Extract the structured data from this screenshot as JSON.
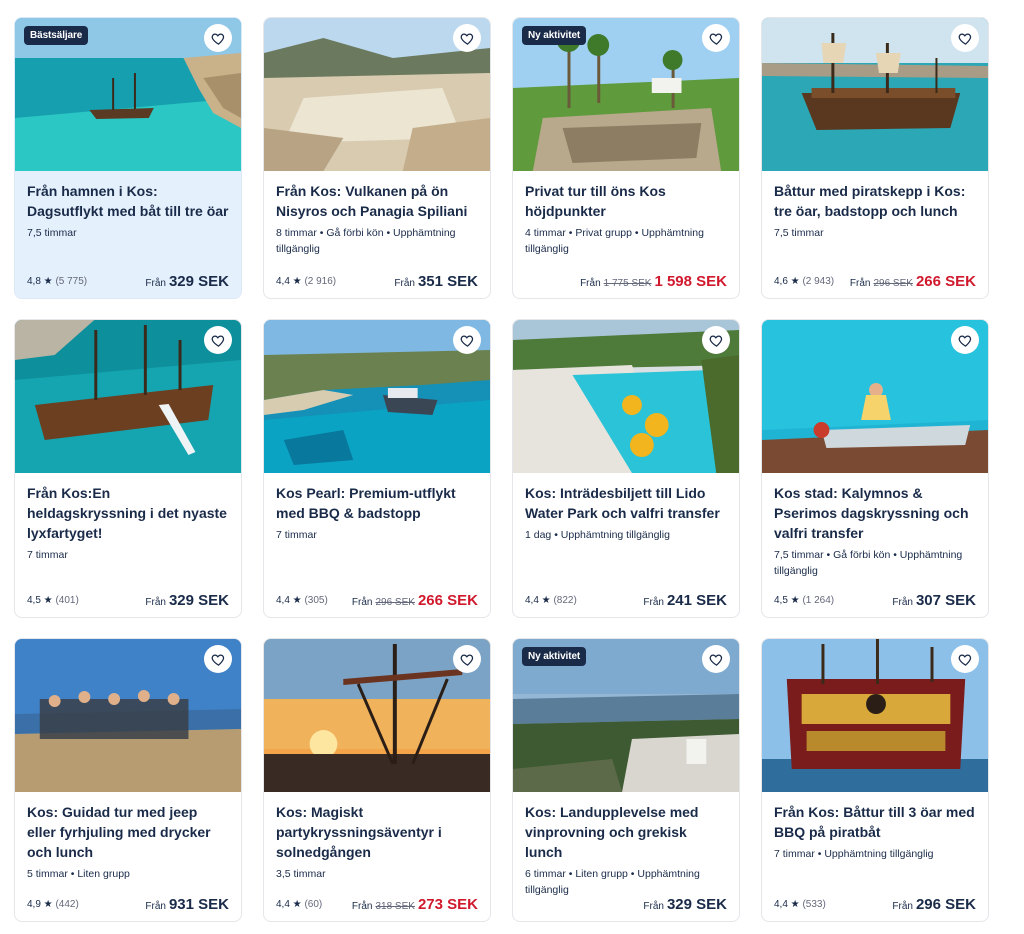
{
  "cards": [
    {
      "badge": "Bästsäljare",
      "title": "Från hamnen i Kos: Dagsutflykt med båt till tre öar",
      "meta": "7,5 timmar",
      "rating": "4,8 ★",
      "count": "(5 775)",
      "from": "Från",
      "old": "",
      "price": "329 SEK"
    },
    {
      "badge": "",
      "title": "Från Kos: Vulkanen på ön Nisyros och Panagia Spiliani",
      "meta": "8 timmar • Gå förbi kön • Upphämtning tillgänglig",
      "rating": "4,4 ★",
      "count": "(2 916)",
      "from": "Från",
      "old": "",
      "price": "351 SEK"
    },
    {
      "badge": "Ny aktivitet",
      "title": "Privat tur till öns Kos höjdpunkter",
      "meta": "4 timmar • Privat grupp • Upphämtning tillgänglig",
      "rating": "",
      "count": "",
      "from": "Från",
      "old": "1 775 SEK",
      "price": "1 598 SEK"
    },
    {
      "badge": "",
      "title": "Båttur med piratskepp i Kos: tre öar, badstopp och lunch",
      "meta": "7,5 timmar",
      "rating": "4,6 ★",
      "count": "(2 943)",
      "from": "Från",
      "old": "296 SEK",
      "price": "266 SEK"
    },
    {
      "badge": "",
      "title": "Från Kos:En heldagskryssning i det nyaste lyxfartyget!",
      "meta": "7 timmar",
      "rating": "4,5 ★",
      "count": "(401)",
      "from": "Från",
      "old": "",
      "price": "329 SEK"
    },
    {
      "badge": "",
      "title": "Kos Pearl: Premium-utflykt med BBQ & badstopp",
      "meta": "7 timmar",
      "rating": "4,4 ★",
      "count": "(305)",
      "from": "Från",
      "old": "296 SEK",
      "price": "266 SEK"
    },
    {
      "badge": "",
      "title": "Kos: Inträdesbiljett till Lido Water Park och valfri transfer",
      "meta": "1 dag • Upphämtning tillgänglig",
      "rating": "4,4 ★",
      "count": "(822)",
      "from": "Från",
      "old": "",
      "price": "241 SEK"
    },
    {
      "badge": "",
      "title": "Kos stad: Kalymnos & Pserimos dagskryssning och valfri transfer",
      "meta": "7,5 timmar • Gå förbi kön • Upphämtning tillgänglig",
      "rating": "4,5 ★",
      "count": "(1 264)",
      "from": "Från",
      "old": "",
      "price": "307 SEK"
    },
    {
      "badge": "",
      "title": "Kos: Guidad tur med jeep eller fyrhjuling med drycker och lunch",
      "meta": "5 timmar • Liten grupp",
      "rating": "4,9 ★",
      "count": "(442)",
      "from": "Från",
      "old": "",
      "price": "931 SEK"
    },
    {
      "badge": "",
      "title": "Kos: Magiskt partykryssningsäventyr i solnedgången",
      "meta": "3,5 timmar",
      "rating": "4,4 ★",
      "count": "(60)",
      "from": "Från",
      "old": "318 SEK",
      "price": "273 SEK"
    },
    {
      "badge": "Ny aktivitet",
      "title": "Kos: Landupplevelse med vinprovning och grekisk lunch",
      "meta": "6 timmar • Liten grupp • Upphämtning tillgänglig",
      "rating": "",
      "count": "",
      "from": "Från",
      "old": "",
      "price": "329 SEK"
    },
    {
      "badge": "",
      "title": "Från Kos: Båttur till 3 öar med BBQ på piratbåt",
      "meta": "7 timmar • Upphämtning tillgänglig",
      "rating": "4,4 ★",
      "count": "(533)",
      "from": "Från",
      "old": "",
      "price": "296 SEK"
    }
  ],
  "colors": {
    "text": "#1a2b49",
    "sale": "#d1192e",
    "highlight": "#e4f0fc",
    "badge": "#1a2b49"
  },
  "icons": {
    "favorite": "heart-outline-icon"
  }
}
